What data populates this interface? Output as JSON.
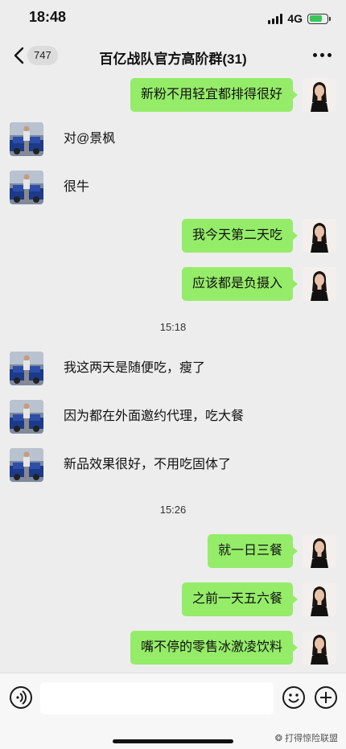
{
  "status": {
    "time": "18:48",
    "network": "4G"
  },
  "nav": {
    "back_count": "747",
    "title": "百亿战队官方高阶群(31)"
  },
  "messages": [
    {
      "side": "out",
      "text": "新粉不用轻宜都排得很好"
    },
    {
      "side": "in",
      "text": "对@景枫"
    },
    {
      "side": "in",
      "text": "很牛"
    },
    {
      "side": "out",
      "text": "我今天第二天吃"
    },
    {
      "side": "out",
      "text": "应该都是负摄入"
    },
    {
      "type": "time",
      "text": "15:18"
    },
    {
      "side": "in",
      "text": "我这两天是随便吃，瘦了"
    },
    {
      "side": "in",
      "text": "因为都在外面邀约代理，吃大餐"
    },
    {
      "side": "in",
      "text": "新品效果很好，不用吃固体了"
    },
    {
      "type": "time",
      "text": "15:26"
    },
    {
      "side": "out",
      "text": "就一日三餐"
    },
    {
      "side": "out",
      "text": "之前一天五六餐"
    },
    {
      "side": "out",
      "text": "嘴不停的零售冰激凌饮料"
    }
  ],
  "watermark": "打得惊险联盟",
  "colors": {
    "out_bubble": "#95ec69",
    "background": "#ededed",
    "battery": "#35c759"
  }
}
